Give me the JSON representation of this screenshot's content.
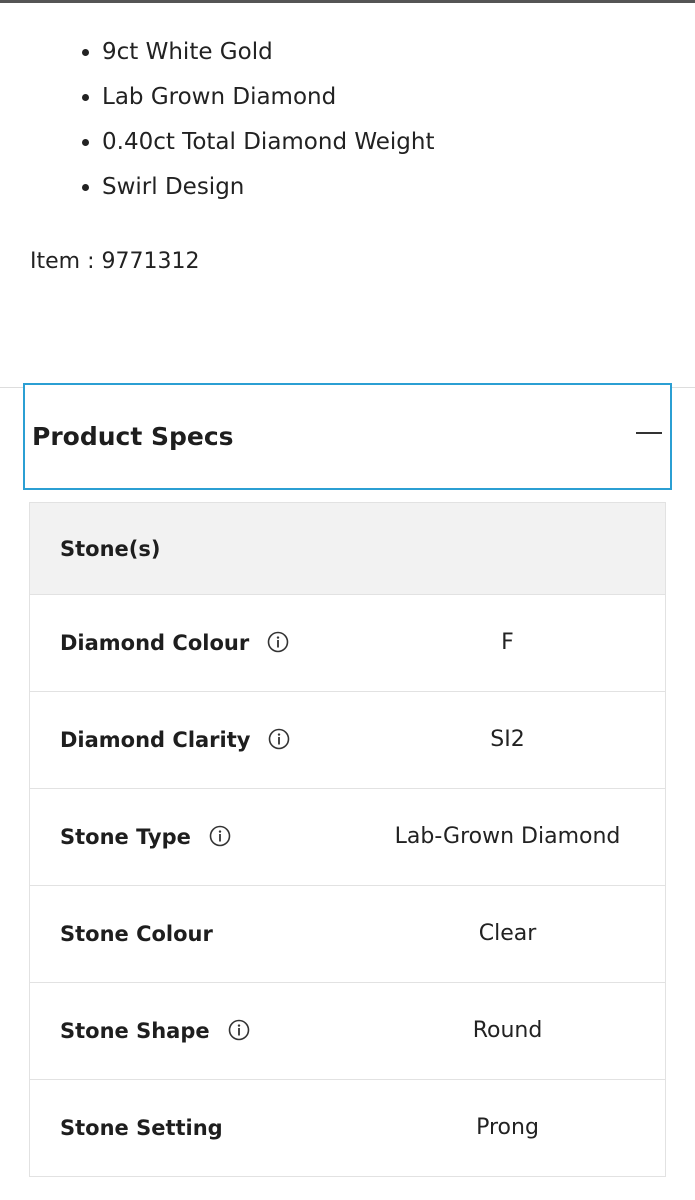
{
  "features": [
    "9ct White Gold",
    "Lab Grown Diamond",
    "0.40ct Total Diamond Weight",
    "Swirl Design"
  ],
  "item": {
    "label": "Item : 9771312"
  },
  "specs": {
    "title": "Product Specs",
    "accent_color": "#2b9fd3",
    "toggle_icon": "minus-icon",
    "group_label": "Stone(s)",
    "rows": [
      {
        "label": "Diamond Colour",
        "value": "F",
        "has_info": true
      },
      {
        "label": "Diamond Clarity",
        "value": "SI2",
        "has_info": true
      },
      {
        "label": "Stone Type",
        "value": "Lab-Grown Diamond",
        "has_info": true
      },
      {
        "label": "Stone Colour",
        "value": "Clear",
        "has_info": false
      },
      {
        "label": "Stone Shape",
        "value": "Round",
        "has_info": true
      },
      {
        "label": "Stone Setting",
        "value": "Prong",
        "has_info": false
      }
    ]
  }
}
